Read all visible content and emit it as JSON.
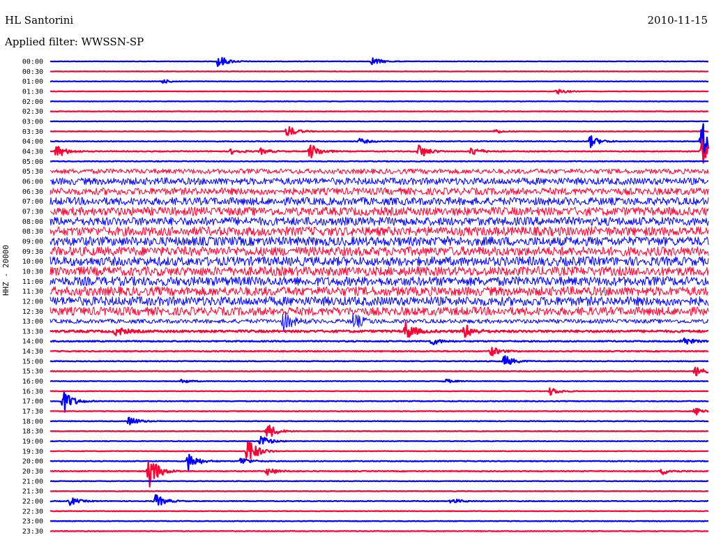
{
  "header": {
    "station": "HL Santorini",
    "date": "2010-11-15",
    "filter_label": "Applied filter: WWSSN-SP",
    "channel_label": "HHZ - 20000"
  },
  "chart_data": {
    "type": "line",
    "title": "HL Santorini",
    "subtitle": "Applied filter: WWSSN-SP",
    "ylabel": "HHZ - 20000",
    "colors": [
      "#0000ff",
      "#ff0033"
    ],
    "row_labels": [
      "00:00",
      "00:30",
      "01:00",
      "01:30",
      "02:00",
      "02:30",
      "03:00",
      "03:30",
      "04:00",
      "04:30",
      "05:00",
      "05:30",
      "06:00",
      "06:30",
      "07:00",
      "07:30",
      "08:00",
      "08:30",
      "09:00",
      "09:30",
      "10:00",
      "10:30",
      "11:00",
      "11:30",
      "12:00",
      "12:30",
      "13:00",
      "13:30",
      "14:00",
      "14:30",
      "15:00",
      "15:30",
      "16:00",
      "16:30",
      "17:00",
      "17:30",
      "18:00",
      "18:30",
      "19:00",
      "19:30",
      "20:00",
      "20:30",
      "21:00",
      "21:30",
      "22:00",
      "22:30",
      "23:00",
      "23:30"
    ],
    "noise_level": [
      0.3,
      0.3,
      0.3,
      0.3,
      0.3,
      0.3,
      0.3,
      0.4,
      0.5,
      0.6,
      0.5,
      3.5,
      5,
      5,
      5.5,
      6,
      6,
      6.5,
      6.5,
      6.5,
      6.5,
      6.5,
      6.5,
      6.5,
      6.5,
      6,
      3,
      1.5,
      0.8,
      0.6,
      0.5,
      0.5,
      0.4,
      0.4,
      0.5,
      0.4,
      0.4,
      0.4,
      0.4,
      0.4,
      0.5,
      0.5,
      0.4,
      0.4,
      0.5,
      0.4,
      0.4,
      0.4
    ],
    "events": [
      {
        "row": 0,
        "t": 0.255,
        "amp": 10
      },
      {
        "row": 0,
        "t": 0.49,
        "amp": 6
      },
      {
        "row": 2,
        "t": 0.17,
        "amp": 3
      },
      {
        "row": 3,
        "t": 0.77,
        "amp": 4
      },
      {
        "row": 7,
        "t": 0.36,
        "amp": 9
      },
      {
        "row": 7,
        "t": 0.675,
        "amp": 3
      },
      {
        "row": 8,
        "t": 0.47,
        "amp": 4
      },
      {
        "row": 8,
        "t": 0.82,
        "amp": 9
      },
      {
        "row": 8,
        "t": 0.99,
        "amp": 30
      },
      {
        "row": 9,
        "t": 0.01,
        "amp": 10
      },
      {
        "row": 9,
        "t": 0.275,
        "amp": 4
      },
      {
        "row": 9,
        "t": 0.32,
        "amp": 4
      },
      {
        "row": 9,
        "t": 0.395,
        "amp": 12
      },
      {
        "row": 9,
        "t": 0.56,
        "amp": 11
      },
      {
        "row": 9,
        "t": 0.64,
        "amp": 7
      },
      {
        "row": 9,
        "t": 0.99,
        "amp": 20
      },
      {
        "row": 26,
        "t": 0.355,
        "amp": 14
      },
      {
        "row": 26,
        "t": 0.46,
        "amp": 12
      },
      {
        "row": 27,
        "t": 0.1,
        "amp": 7
      },
      {
        "row": 27,
        "t": 0.54,
        "amp": 13
      },
      {
        "row": 27,
        "t": 0.63,
        "amp": 10
      },
      {
        "row": 28,
        "t": 0.58,
        "amp": 5
      },
      {
        "row": 28,
        "t": 0.96,
        "amp": 7
      },
      {
        "row": 29,
        "t": 0.67,
        "amp": 7
      },
      {
        "row": 30,
        "t": 0.69,
        "amp": 9
      },
      {
        "row": 31,
        "t": 0.98,
        "amp": 7
      },
      {
        "row": 32,
        "t": 0.2,
        "amp": 3
      },
      {
        "row": 32,
        "t": 0.6,
        "amp": 3
      },
      {
        "row": 33,
        "t": 0.76,
        "amp": 6
      },
      {
        "row": 34,
        "t": 0.02,
        "amp": 18
      },
      {
        "row": 35,
        "t": 0.98,
        "amp": 6
      },
      {
        "row": 36,
        "t": 0.12,
        "amp": 7
      },
      {
        "row": 37,
        "t": 0.33,
        "amp": 12
      },
      {
        "row": 38,
        "t": 0.32,
        "amp": 9
      },
      {
        "row": 39,
        "t": 0.3,
        "amp": 22
      },
      {
        "row": 40,
        "t": 0.21,
        "amp": 14
      },
      {
        "row": 40,
        "t": 0.29,
        "amp": 6
      },
      {
        "row": 41,
        "t": 0.15,
        "amp": 28
      },
      {
        "row": 41,
        "t": 0.33,
        "amp": 6
      },
      {
        "row": 41,
        "t": 0.93,
        "amp": 5
      },
      {
        "row": 44,
        "t": 0.03,
        "amp": 6
      },
      {
        "row": 44,
        "t": 0.16,
        "amp": 10
      },
      {
        "row": 44,
        "t": 0.61,
        "amp": 4
      }
    ]
  }
}
